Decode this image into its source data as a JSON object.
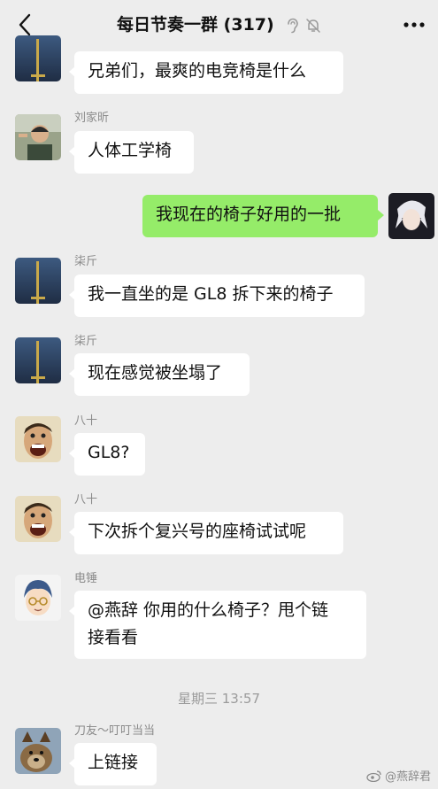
{
  "header": {
    "title": "每日节奏一群 (317)"
  },
  "messages": [
    {
      "sender": "",
      "text": "兄弟们，最爽的电竞椅是什么"
    },
    {
      "sender": "刘家昕",
      "text": "人体工学椅"
    },
    {
      "sender": "",
      "text": "我现在的椅子好用的一批",
      "self": true
    },
    {
      "sender": "柒斤",
      "text": "我一直坐的是 GL8 拆下来的椅子"
    },
    {
      "sender": "柒斤",
      "text": "现在感觉被坐塌了"
    },
    {
      "sender": "八十",
      "text": "GL8?"
    },
    {
      "sender": "八十",
      "text": "下次拆个复兴号的座椅试试呢"
    },
    {
      "sender": "电锤",
      "text_line1": "@燕辞 你用的什么椅子？甩个链",
      "text_line2": "接看看"
    },
    {
      "sender": "刀友～叮叮当当",
      "text": "上链接"
    }
  ],
  "timestamp": "星期三 13:57",
  "watermark": "@燕辞君",
  "colors": {
    "background": "#ededed",
    "self_bubble": "#95ec69",
    "other_bubble": "#ffffff"
  }
}
